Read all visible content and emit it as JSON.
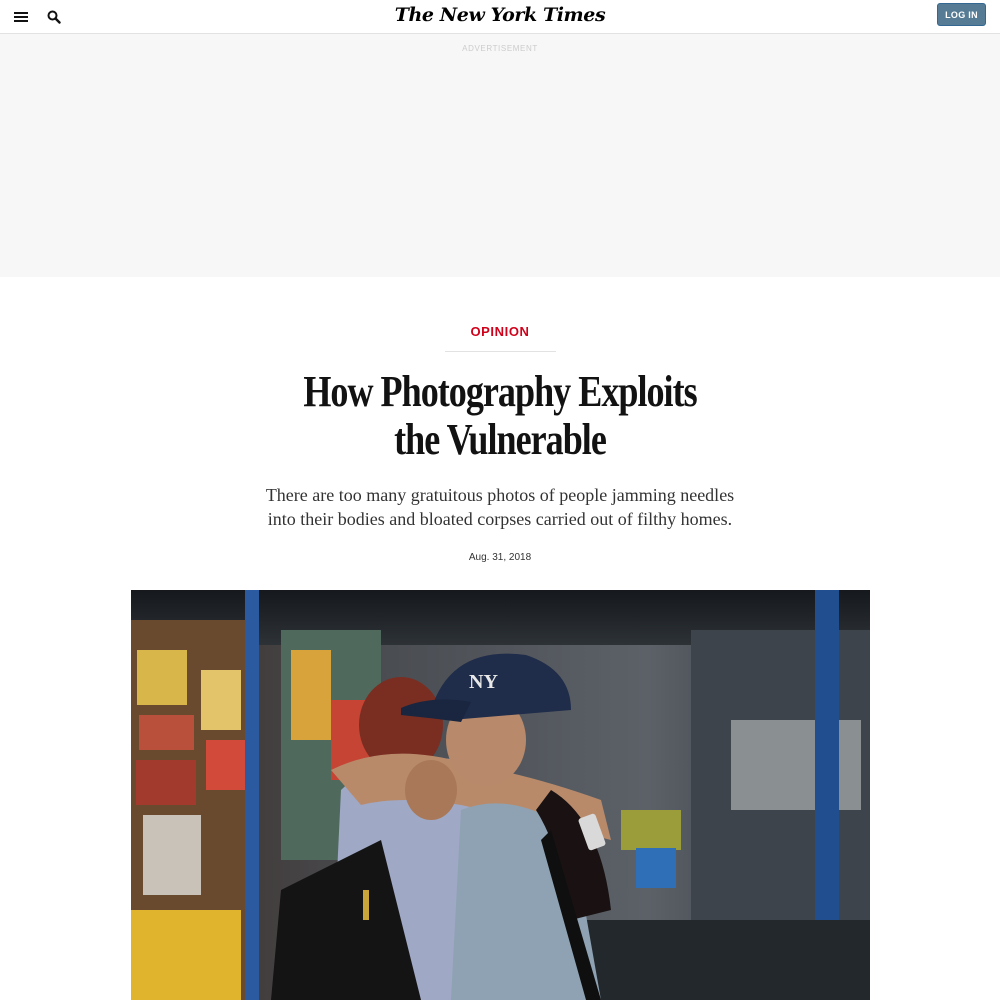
{
  "header": {
    "logo_text": "The New York Times",
    "login_label": "LOG IN",
    "menu_icon": "hamburger-menu-icon",
    "search_icon": "search-icon"
  },
  "ad": {
    "label": "ADVERTISEMENT"
  },
  "article": {
    "kicker": "OPINION",
    "headline": "How Photography Exploits the Vulnerable",
    "summary": "There are too many gratuitous photos of people jamming needles into their bodies and bloated corpses carried out of filthy homes.",
    "date": "Aug. 31, 2018"
  },
  "photo": {
    "cap_logo": "NY"
  },
  "colors": {
    "kicker_red": "#d0021b",
    "login_blue": "#567b95",
    "ad_background": "#f7f7f7"
  }
}
